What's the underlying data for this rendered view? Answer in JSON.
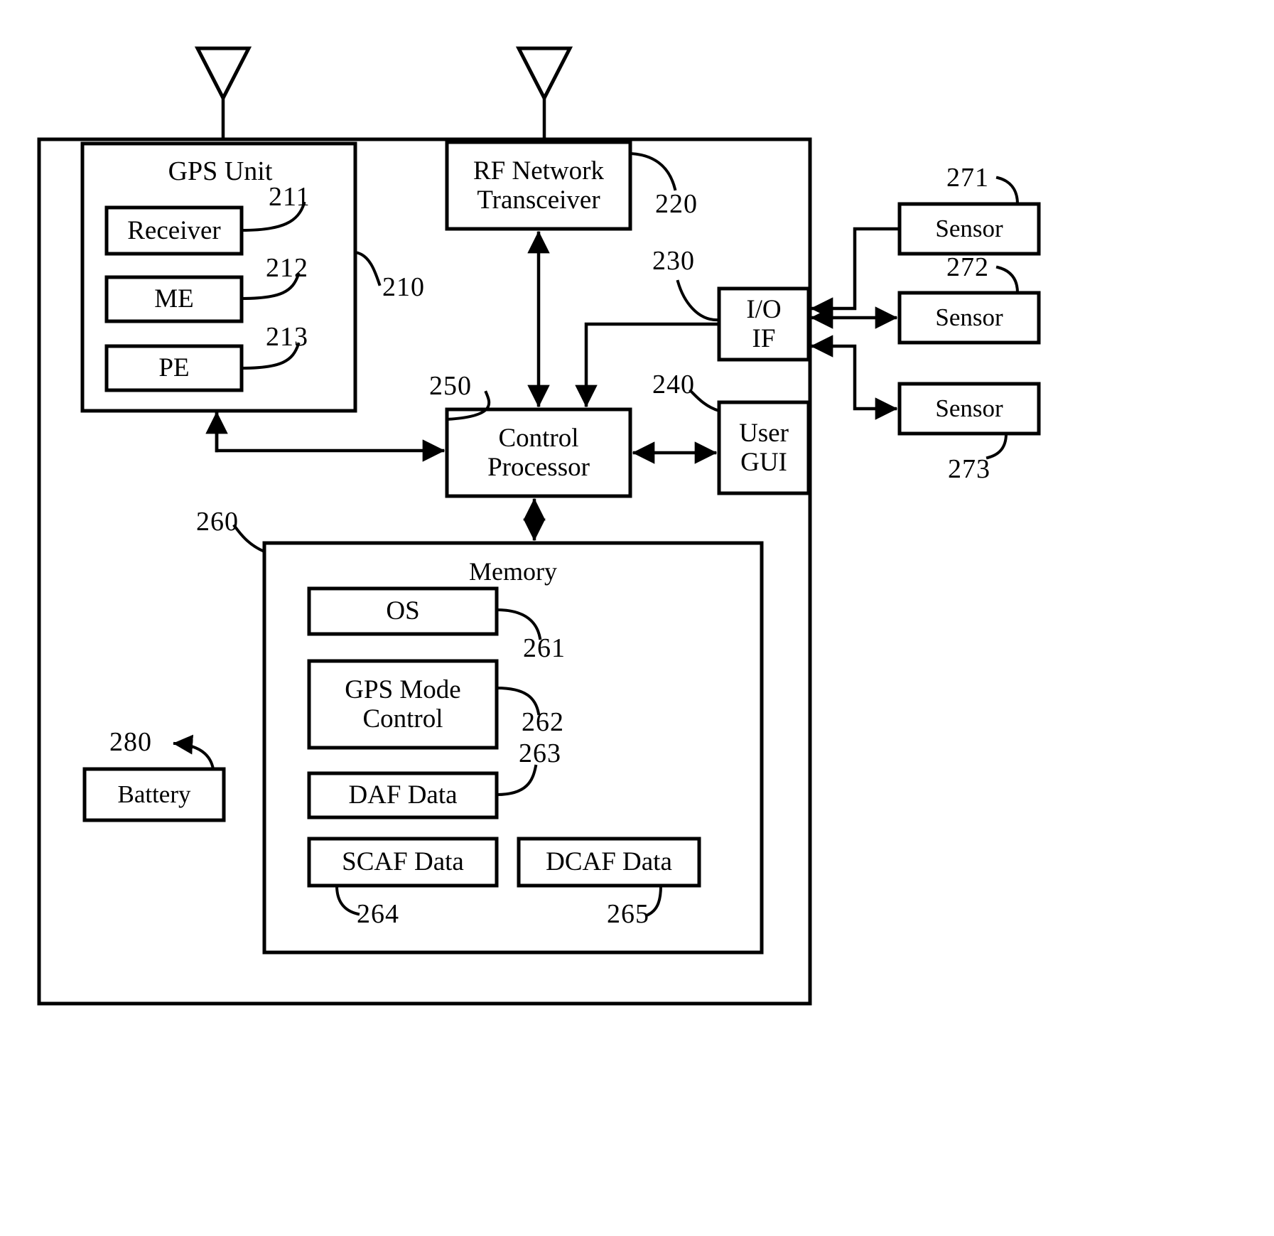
{
  "figure": {
    "type": "patent-block-diagram",
    "description": "Mobile device block diagram with GPS unit, RF network transceiver, control processor, memory and sensors"
  },
  "device": {
    "gps_unit": {
      "title": "GPS Unit",
      "ref": "210",
      "components": [
        {
          "label": "Receiver",
          "ref": "211"
        },
        {
          "label": "ME",
          "ref": "212"
        },
        {
          "label": "PE",
          "ref": "213"
        }
      ]
    },
    "rf_transceiver": {
      "label": "RF Network\nTransceiver",
      "ref": "220"
    },
    "io_if": {
      "label": "I/O\nIF",
      "ref": "230"
    },
    "user_gui": {
      "label": "User\nGUI",
      "ref": "240"
    },
    "control_processor": {
      "label": "Control\nProcessor",
      "ref": "250"
    },
    "memory": {
      "title": "Memory",
      "ref": "260",
      "items": [
        {
          "label": "OS",
          "ref": "261"
        },
        {
          "label": "GPS Mode\nControl",
          "ref": "262"
        },
        {
          "label": "DAF Data",
          "ref": "263"
        },
        {
          "label": "SCAF Data",
          "ref": "264"
        },
        {
          "label": "DCAF Data",
          "ref": "265"
        }
      ]
    },
    "battery": {
      "label": "Battery",
      "ref": "280"
    }
  },
  "sensors": [
    {
      "label": "Sensor",
      "ref": "271"
    },
    {
      "label": "Sensor",
      "ref": "272"
    },
    {
      "label": "Sensor",
      "ref": "273"
    }
  ],
  "antennas": [
    {
      "name": "gps-antenna"
    },
    {
      "name": "rf-antenna"
    }
  ],
  "colors": {
    "line": "#000000",
    "background": "#ffffff",
    "text": "#000000"
  }
}
